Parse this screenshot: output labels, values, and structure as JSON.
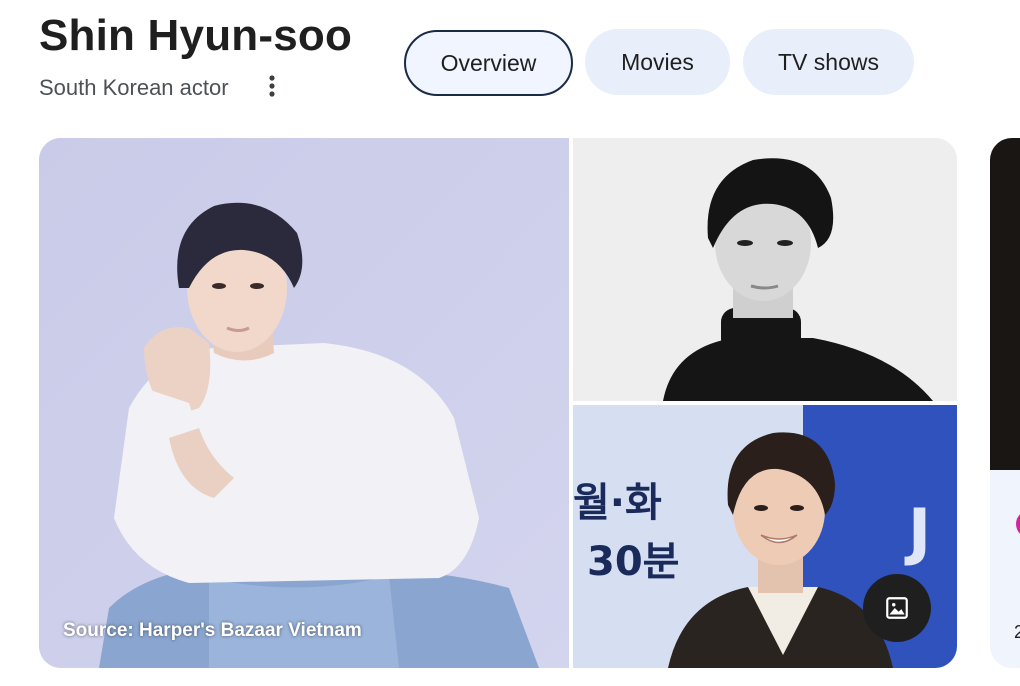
{
  "header": {
    "title": "Shin Hyun-soo",
    "subtitle": "South Korean actor"
  },
  "tabs": [
    {
      "label": "Overview",
      "active": true
    },
    {
      "label": "Movies",
      "active": false
    },
    {
      "label": "TV shows",
      "active": false
    }
  ],
  "gallery": {
    "main_source": "Source: Harper's Bazaar Vietnam",
    "event_backdrop_line1": "월·화",
    "event_backdrop_line2": "30분",
    "event_backdrop_logo": "J"
  },
  "side_card": {
    "text": "2"
  },
  "icons": {
    "more": "more-vert-icon",
    "image": "image-icon"
  },
  "colors": {
    "chip_bg": "#e8effb",
    "chip_active_border": "#1b2a44"
  }
}
